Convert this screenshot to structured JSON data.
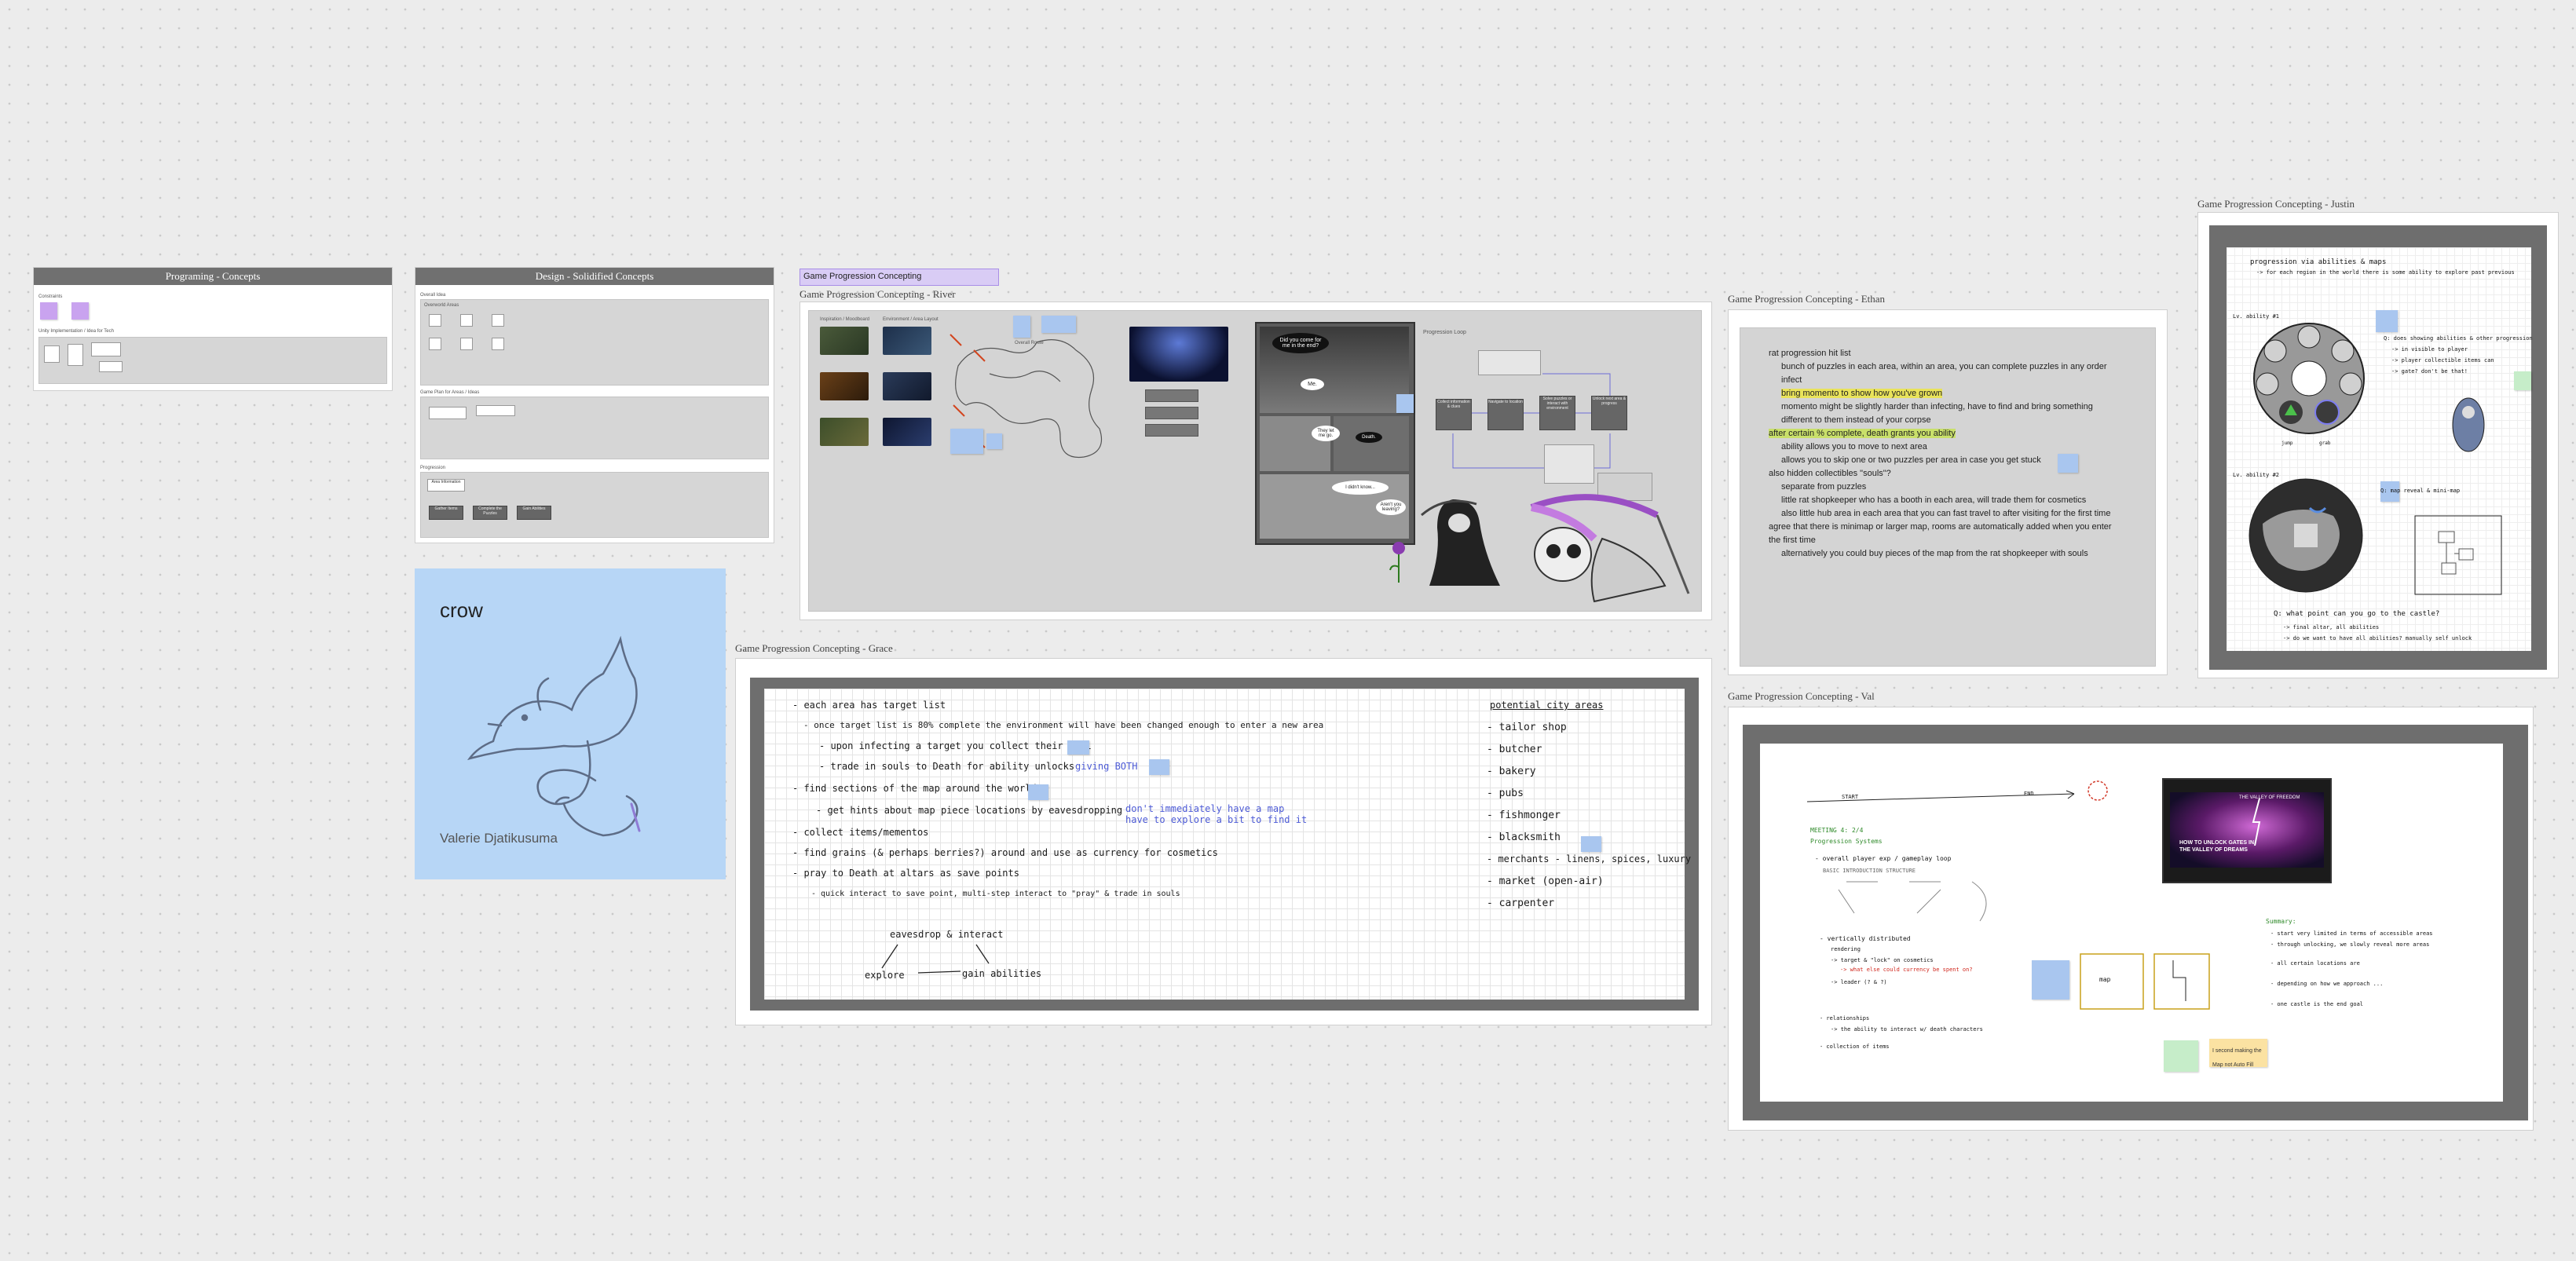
{
  "canvas": {
    "background": "#ececec",
    "dot_color": "#c9c9c9"
  },
  "programming": {
    "title": "Programing - Concepts",
    "mini_labels": [
      "Constraints",
      "Unity Implementation / Idea for Tech"
    ]
  },
  "design": {
    "title": "Design - Solidified Concepts",
    "block_labels": [
      "Overall Idea",
      "Overworld Areas",
      "Game Plan for Areas / Ideas",
      "Progression"
    ],
    "progress_boxes": [
      "Area Information",
      "Gather Items",
      "Complete the Puzzles",
      "Gain Abilities"
    ]
  },
  "crow": {
    "title": "crow",
    "author": "Valerie Djatikusuma",
    "bg": "#b7d6f6"
  },
  "river": {
    "tag": "Game Progression Concepting",
    "label": "Game Progression Concepting - River",
    "thumb_labels": [
      "Inspiration / Moodboard",
      "Environment / Area Layout"
    ],
    "map_label": "Overall Route",
    "loop_title": "Progression Loop",
    "loop_boxes": [
      "Collect information & clues",
      "Navigate to location",
      "Solve puzzles or interact with environment",
      "Unlock next area & progress"
    ],
    "bubbles": [
      "Did you come for me in the end?",
      "Me.",
      "They let me go.",
      "Death.",
      "I didn't know...",
      "Aren't you leaving?"
    ]
  },
  "ethan": {
    "label": "Game Progression Concepting - Ethan",
    "lines": [
      "rat progression  hit list",
      "bunch of puzzles in each area, within an area, you can complete puzzles in any order",
      "infect",
      "bring momento to show how you've grown",
      "momento might be slightly harder than infecting, have to find and bring something",
      "different to them instead of your corpse",
      "after certain % complete, death grants you ability",
      "ability allows you to move to next area",
      "allows you to skip one or two puzzles per area in case you get stuck",
      "also hidden collectibles \"souls\"?",
      "separate from puzzles",
      "little rat shopkeeper who has a booth in each area, will trade them for cosmetics",
      "also little hub area in each area that you can fast travel to after visiting for the first time",
      "agree that there is minimap or larger map, rooms are automatically added when you enter",
      "the first time",
      "alternatively you could buy pieces of the map from the rat shopkeeper with souls"
    ]
  },
  "grace": {
    "label": "Game Progression Concepting - Grace",
    "lines": [
      "- each area has target list",
      "- once target list is 80% complete the environment will have been changed enough to enter a new area",
      "- upon infecting a target you collect their soul",
      "- trade in souls to Death for ability unlocks",
      "giving BOTH",
      "- find sections of the map around the world",
      "- get hints about map piece locations by eavesdropping",
      "don't immediately have a map",
      "have to explore a bit to find it",
      "- collect items/mementos",
      "- find grains (& perhaps berries?) around and use as currency for cosmetics",
      "- pray to Death at altars as save points",
      "- quick interact to save point, multi-step interact to \"pray\" & trade in souls",
      "eavesdrop & interact",
      "explore",
      "gain abilities"
    ],
    "city_title": "potential city areas",
    "city_items": [
      "- tailor shop",
      "- butcher",
      "- bakery",
      "- pubs",
      "- fishmonger",
      "- blacksmith",
      "- merchants - linens, spices, luxury",
      "- market (open-air)",
      "- carpenter"
    ]
  },
  "justin": {
    "label": "Game Progression Concepting - Justin",
    "lines": [
      "progression via abilities & maps",
      "-> for each region in the world there is some ability to explore past previous",
      "Lv. ability #1",
      "Q: does showing abilities & other progression",
      "-> in visible to player",
      "-> player collectible items can",
      "-> gate? don't be that!",
      "jump",
      "grab",
      "Lv. ability #2",
      "Q: map reveal & mini-map",
      "Q: what point can you go to the castle?",
      "-> final altar, all abilities",
      "-> do we want to have all abilities? manually self unlock"
    ]
  },
  "val": {
    "label": "Game Progression Concepting - Val",
    "lines": [
      "MEETING 4: 2/4",
      "Progression Systems",
      "- overall player exp / gameplay loop",
      "BASIC INTRODUCTION STRUCTURE",
      "- vertically distributed",
      "rendering",
      "-> target & \"lock\" on cosmetics",
      "-> what else could currency be spent on?",
      "-> leader (? & ?)",
      "- relationships",
      "-> the ability to interact w/ death characters",
      "- collection of items",
      "Summary:",
      "- start very limited in terms of accessible areas",
      "- through unlocking, we slowly reveal more areas",
      "- all certain locations are",
      "- depending on how we approach ...",
      "- one castle is the end goal"
    ],
    "video_title": "THE VALLEY OF FREEDOM",
    "video_caption": "HOW TO UNLOCK GATES IN THE VALLEY OF DREAMS",
    "sticky_text": "I second making the Map not Auto Fill",
    "map_label": "map",
    "start_label": "START",
    "end_label": "END"
  }
}
